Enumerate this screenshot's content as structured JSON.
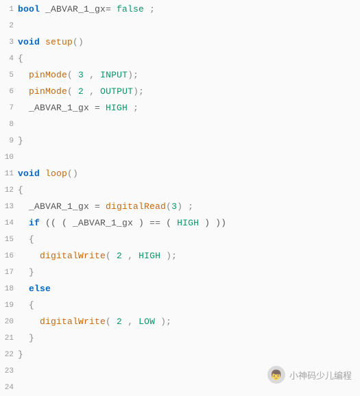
{
  "lines": [
    {
      "n": "1",
      "tokens": [
        {
          "t": "bool",
          "c": "kw"
        },
        {
          "t": " _ABVAR_1_gx",
          "c": "id"
        },
        {
          "t": "= ",
          "c": "op"
        },
        {
          "t": "false",
          "c": "bool"
        },
        {
          "t": " ;",
          "c": "punc"
        }
      ]
    },
    {
      "n": "2",
      "tokens": []
    },
    {
      "n": "3",
      "tokens": [
        {
          "t": "void",
          "c": "kw"
        },
        {
          "t": " ",
          "c": "id"
        },
        {
          "t": "setup",
          "c": "fn"
        },
        {
          "t": "()",
          "c": "punc"
        }
      ]
    },
    {
      "n": "4",
      "tokens": [
        {
          "t": "{",
          "c": "punc"
        }
      ]
    },
    {
      "n": "5",
      "tokens": [
        {
          "t": "  ",
          "c": "id"
        },
        {
          "t": "pinMode",
          "c": "fn"
        },
        {
          "t": "( ",
          "c": "punc"
        },
        {
          "t": "3",
          "c": "num"
        },
        {
          "t": " , ",
          "c": "punc"
        },
        {
          "t": "INPUT",
          "c": "const"
        },
        {
          "t": ");",
          "c": "punc"
        }
      ]
    },
    {
      "n": "6",
      "tokens": [
        {
          "t": "  ",
          "c": "id"
        },
        {
          "t": "pinMode",
          "c": "fn"
        },
        {
          "t": "( ",
          "c": "punc"
        },
        {
          "t": "2",
          "c": "num"
        },
        {
          "t": " , ",
          "c": "punc"
        },
        {
          "t": "OUTPUT",
          "c": "const"
        },
        {
          "t": ");",
          "c": "punc"
        }
      ]
    },
    {
      "n": "7",
      "tokens": [
        {
          "t": "  _ABVAR_1_gx ",
          "c": "id"
        },
        {
          "t": "= ",
          "c": "op"
        },
        {
          "t": "HIGH",
          "c": "const"
        },
        {
          "t": " ;",
          "c": "punc"
        }
      ]
    },
    {
      "n": "8",
      "tokens": []
    },
    {
      "n": "9",
      "tokens": [
        {
          "t": "}",
          "c": "punc"
        }
      ]
    },
    {
      "n": "10",
      "tokens": []
    },
    {
      "n": "11",
      "tokens": [
        {
          "t": "void",
          "c": "kw"
        },
        {
          "t": " ",
          "c": "id"
        },
        {
          "t": "loop",
          "c": "fn"
        },
        {
          "t": "()",
          "c": "punc"
        }
      ]
    },
    {
      "n": "12",
      "tokens": [
        {
          "t": "{",
          "c": "punc"
        }
      ]
    },
    {
      "n": "13",
      "tokens": [
        {
          "t": "  _ABVAR_1_gx ",
          "c": "id"
        },
        {
          "t": "= ",
          "c": "op"
        },
        {
          "t": "digitalRead",
          "c": "fn"
        },
        {
          "t": "(",
          "c": "punc"
        },
        {
          "t": "3",
          "c": "num"
        },
        {
          "t": ") ;",
          "c": "punc"
        }
      ]
    },
    {
      "n": "14",
      "tokens": [
        {
          "t": "  ",
          "c": "id"
        },
        {
          "t": "if",
          "c": "kw"
        },
        {
          "t": " (( ( _ABVAR_1_gx ) ",
          "c": "id"
        },
        {
          "t": "==",
          "c": "op"
        },
        {
          "t": " ( ",
          "c": "id"
        },
        {
          "t": "HIGH",
          "c": "const"
        },
        {
          "t": " ) ))",
          "c": "id"
        }
      ]
    },
    {
      "n": "15",
      "tokens": [
        {
          "t": "  {",
          "c": "punc"
        }
      ]
    },
    {
      "n": "16",
      "tokens": [
        {
          "t": "    ",
          "c": "id"
        },
        {
          "t": "digitalWrite",
          "c": "fn"
        },
        {
          "t": "( ",
          "c": "punc"
        },
        {
          "t": "2",
          "c": "num"
        },
        {
          "t": " , ",
          "c": "punc"
        },
        {
          "t": "HIGH",
          "c": "const"
        },
        {
          "t": " );",
          "c": "punc"
        }
      ]
    },
    {
      "n": "17",
      "tokens": [
        {
          "t": "  }",
          "c": "punc"
        }
      ]
    },
    {
      "n": "18",
      "tokens": [
        {
          "t": "  ",
          "c": "id"
        },
        {
          "t": "else",
          "c": "kw"
        }
      ]
    },
    {
      "n": "19",
      "tokens": [
        {
          "t": "  {",
          "c": "punc"
        }
      ]
    },
    {
      "n": "20",
      "tokens": [
        {
          "t": "    ",
          "c": "id"
        },
        {
          "t": "digitalWrite",
          "c": "fn"
        },
        {
          "t": "( ",
          "c": "punc"
        },
        {
          "t": "2",
          "c": "num"
        },
        {
          "t": " , ",
          "c": "punc"
        },
        {
          "t": "LOW",
          "c": "const"
        },
        {
          "t": " );",
          "c": "punc"
        }
      ]
    },
    {
      "n": "21",
      "tokens": [
        {
          "t": "  }",
          "c": "punc"
        }
      ]
    },
    {
      "n": "22",
      "tokens": [
        {
          "t": "}",
          "c": "punc"
        }
      ]
    },
    {
      "n": "23",
      "tokens": []
    },
    {
      "n": "24",
      "tokens": []
    }
  ],
  "watermark": {
    "text": "小神码少儿编程",
    "icon": "👦"
  }
}
